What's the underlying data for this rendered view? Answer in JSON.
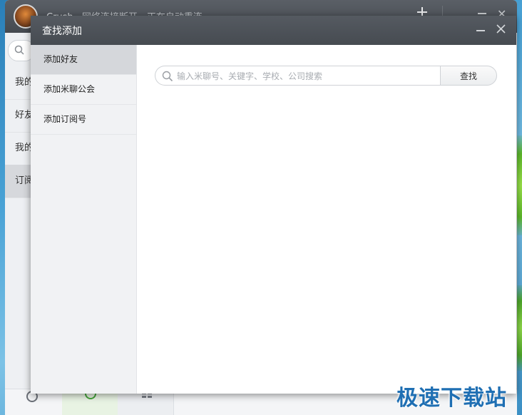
{
  "background_app": {
    "title": "Crush",
    "status": "网络连接断开，正在自动重连",
    "list_items": [
      "我的",
      "好友",
      "我的",
      "订阅"
    ],
    "active_item_index": 3
  },
  "dialog": {
    "title": "查找添加",
    "sidebar": {
      "items": [
        {
          "label": "添加好友",
          "active": true
        },
        {
          "label": "添加米聊公会",
          "active": false
        },
        {
          "label": "添加订阅号",
          "active": false
        }
      ]
    },
    "search": {
      "placeholder": "输入米聊号、关键字、学校、公司搜索",
      "value": "",
      "button_label": "查找"
    }
  },
  "watermark": "极速下载站",
  "colors": {
    "titlebar": "#4d5258",
    "sidebar_bg": "#f1f2f4",
    "sidebar_active": "#d5d7db",
    "watermark": "#1f6fb3"
  },
  "icons": [
    "search-icon",
    "minimize-icon",
    "close-icon",
    "add-icon"
  ]
}
